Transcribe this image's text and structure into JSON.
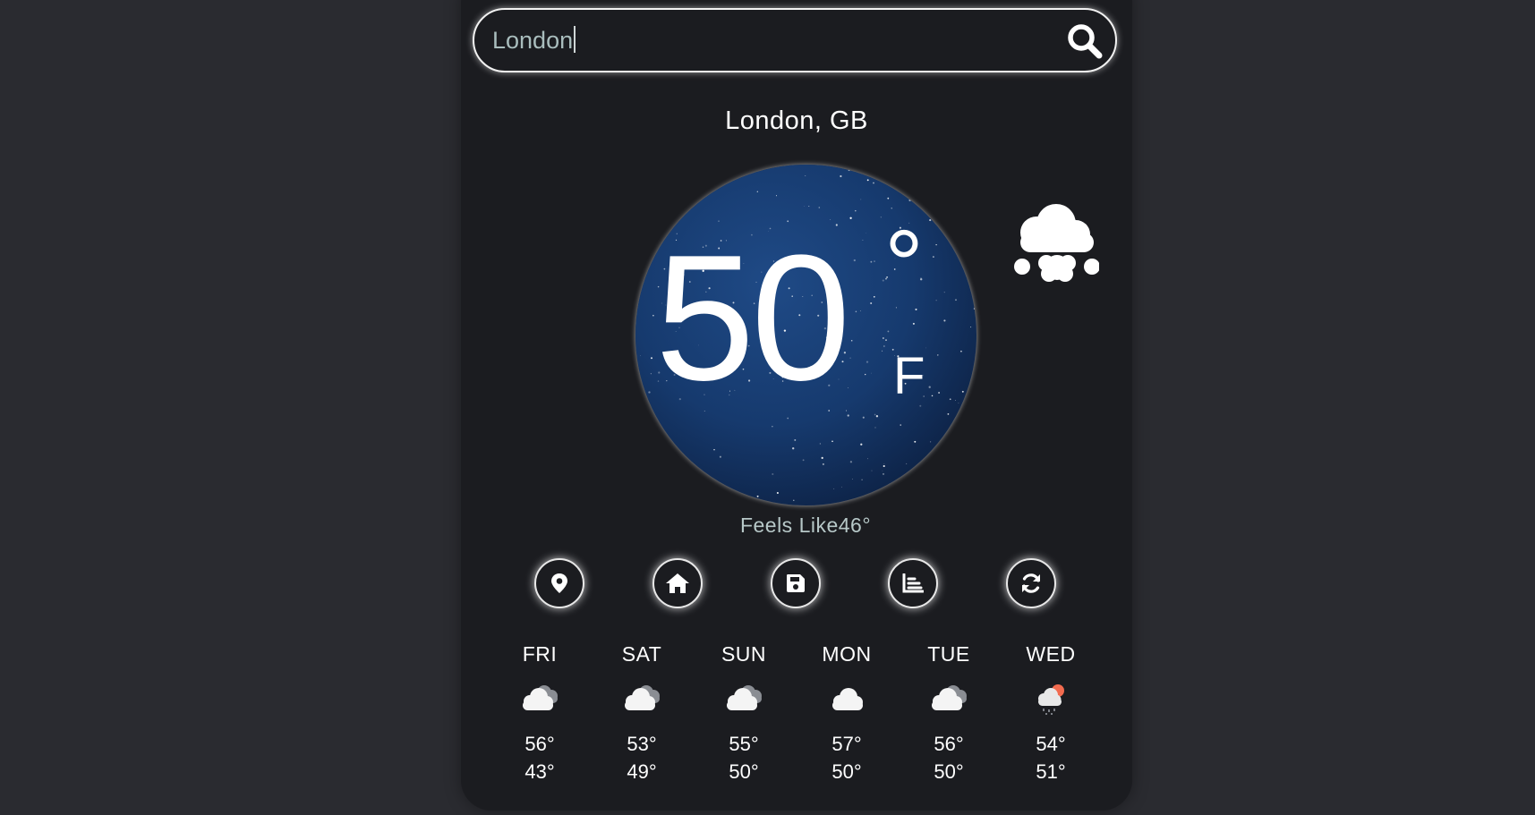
{
  "search": {
    "value": "London",
    "icon": "search-icon"
  },
  "location": "London, GB",
  "current": {
    "temp": "50",
    "degree_symbol": "°",
    "unit": "F",
    "feels_like": "Feels Like46°",
    "condition_icon": "cloud-snow-icon"
  },
  "actions": [
    {
      "icon": "map-pin-icon"
    },
    {
      "icon": "home-icon"
    },
    {
      "icon": "save-icon"
    },
    {
      "icon": "chart-icon"
    },
    {
      "icon": "refresh-icon"
    }
  ],
  "forecast": [
    {
      "day": "FRI",
      "hi": "56°",
      "lo": "43°",
      "icon": "cloudy-icon"
    },
    {
      "day": "SAT",
      "hi": "53°",
      "lo": "49°",
      "icon": "cloudy-icon"
    },
    {
      "day": "SUN",
      "hi": "55°",
      "lo": "50°",
      "icon": "cloudy-icon"
    },
    {
      "day": "MON",
      "hi": "57°",
      "lo": "50°",
      "icon": "cloud-icon"
    },
    {
      "day": "TUE",
      "hi": "56°",
      "lo": "50°",
      "icon": "cloudy-icon"
    },
    {
      "day": "WED",
      "hi": "54°",
      "lo": "51°",
      "icon": "rain-sun-icon"
    }
  ],
  "colors": {
    "page_bg": "#2a2b30",
    "card_bg": "#1b1c20",
    "text": "#ffffff",
    "muted_text": "#b7c8c8",
    "sun_accent": "#f26b4f"
  }
}
